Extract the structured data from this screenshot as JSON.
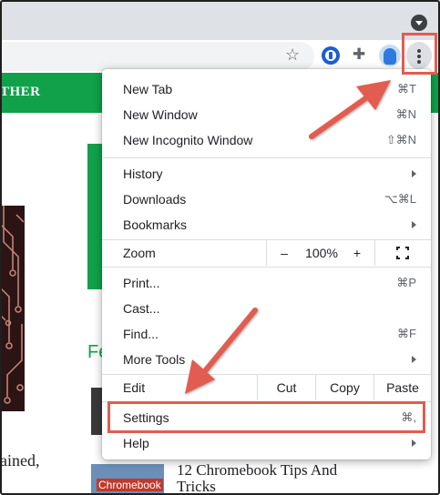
{
  "browser": {
    "toolbar_icons": [
      "star-icon",
      "password-manager-icon",
      "extensions-puzzle-icon",
      "profile-avatar-icon",
      "three-dot-menu-icon"
    ],
    "tab_search_icon": "tab-search-icon"
  },
  "page": {
    "nav_text": "THER",
    "heading_fragment": "Fe",
    "body_fragment": "ained,",
    "article_title": "12 Chromebook Tips And Tricks",
    "thumb_caption": "Chromebook"
  },
  "menu": {
    "new_tab": {
      "label": "New Tab",
      "shortcut": "⌘T"
    },
    "new_window": {
      "label": "New Window",
      "shortcut": "⌘N"
    },
    "new_incognito": {
      "label": "New Incognito Window",
      "shortcut": "⇧⌘N"
    },
    "history": {
      "label": "History"
    },
    "downloads": {
      "label": "Downloads",
      "shortcut": "⌥⌘L"
    },
    "bookmarks": {
      "label": "Bookmarks"
    },
    "zoom": {
      "label": "Zoom",
      "minus": "–",
      "value": "100%",
      "plus": "+"
    },
    "print": {
      "label": "Print...",
      "shortcut": "⌘P"
    },
    "cast": {
      "label": "Cast..."
    },
    "find": {
      "label": "Find...",
      "shortcut": "⌘F"
    },
    "more_tools": {
      "label": "More Tools"
    },
    "edit": {
      "label": "Edit",
      "cut": "Cut",
      "copy": "Copy",
      "paste": "Paste"
    },
    "settings": {
      "label": "Settings",
      "shortcut": "⌘,"
    },
    "help": {
      "label": "Help"
    }
  },
  "colors": {
    "highlight": "#e25c4f",
    "site_green": "#10a14a"
  }
}
